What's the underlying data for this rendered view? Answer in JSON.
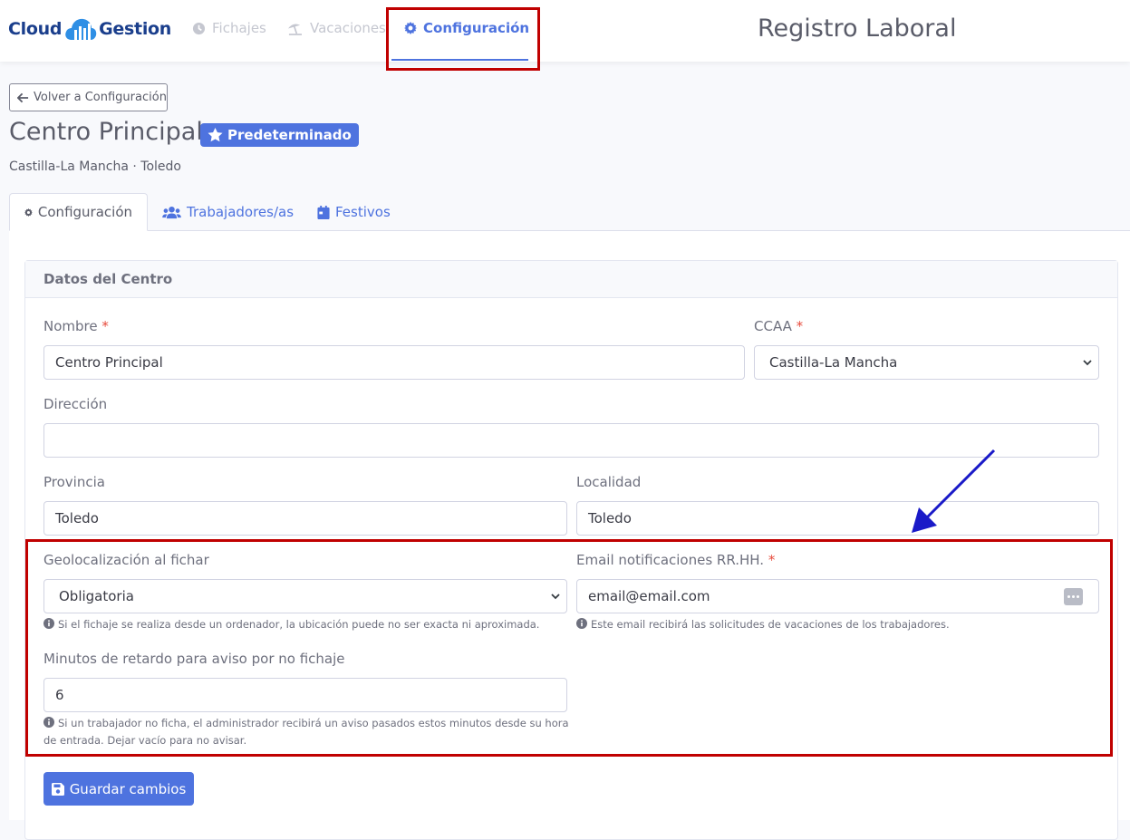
{
  "brand": {
    "part1": "Cloud",
    "part2": "Gestion"
  },
  "nav": {
    "items": [
      {
        "label": "Fichajes",
        "icon": "clock-icon"
      },
      {
        "label": "Vacaciones",
        "icon": "beach-umbrella-icon"
      },
      {
        "label": "Configuración",
        "icon": "gear-icon",
        "active": true
      }
    ]
  },
  "header": {
    "title": "Registro Laboral"
  },
  "back_button": {
    "label": "Volver a Configuración",
    "icon": "arrow-left-icon"
  },
  "center": {
    "title": "Centro Principal",
    "badge": "Predeterminado",
    "subtitle": "Castilla-La Mancha · Toledo"
  },
  "tabs": [
    {
      "label": "Configuración",
      "icon": "gear-icon",
      "active": true
    },
    {
      "label": "Trabajadores/as",
      "icon": "users-icon"
    },
    {
      "label": "Festivos",
      "icon": "calendar-icon"
    }
  ],
  "card": {
    "header": "Datos del Centro",
    "fields": {
      "nombre": {
        "label": "Nombre",
        "required": "*",
        "value": "Centro Principal"
      },
      "ccaa": {
        "label": "CCAA",
        "required": "*",
        "value": "Castilla-La Mancha"
      },
      "direccion": {
        "label": "Dirección",
        "value": ""
      },
      "provincia": {
        "label": "Provincia",
        "value": "Toledo"
      },
      "localidad": {
        "label": "Localidad",
        "value": "Toledo"
      },
      "geolocalizacion": {
        "label": "Geolocalización al fichar",
        "value": "Obligatoria",
        "help": "Si el fichaje se realiza desde un ordenador, la ubicación puede no ser exacta ni aproximada."
      },
      "email": {
        "label": "Email notificaciones RR.HH.",
        "required": "*",
        "value": "email@email.com",
        "help": "Este email recibirá las solicitudes de vacaciones de los trabajadores."
      },
      "minutos": {
        "label": "Minutos de retardo para aviso por no fichaje",
        "value": "6",
        "help_line1": "Si un trabajador no ficha, el administrador recibirá un aviso pasados estos minutos desde su hora",
        "help_line2": "de entrada. Dejar vacío para no avisar."
      }
    },
    "save_label": "Guardar cambios"
  },
  "colors": {
    "primary": "#4e73df",
    "annotation_red": "#c00000",
    "annotation_arrow": "#1a1ac8"
  }
}
